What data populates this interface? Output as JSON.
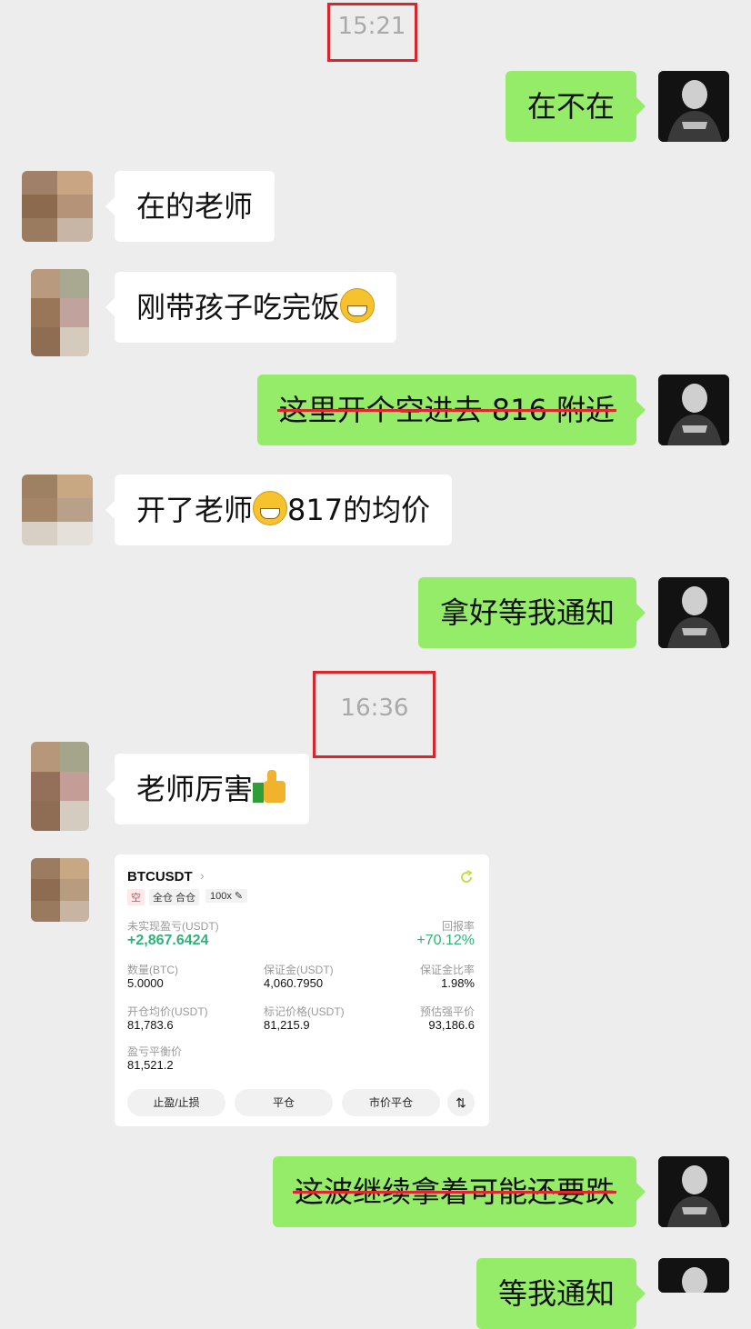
{
  "timestamps": [
    "15:21",
    "16:36"
  ],
  "messages": [
    {
      "text": "在不在"
    },
    {
      "text": "在的老师"
    },
    {
      "text": "刚带孩子吃完饭"
    },
    {
      "text": "这里开个空进去 816 附近"
    },
    {
      "text_before": "开了老师",
      "text_after": "817的均价"
    },
    {
      "text": "拿好等我通知"
    },
    {
      "text": "老师厉害"
    },
    {
      "text": "这波继续拿着可能还要跌"
    },
    {
      "text": "等我通知"
    }
  ],
  "icons": [
    "grinning-face-icon",
    "thumbs-up-icon",
    "refresh-icon",
    "chevron-right-icon",
    "swap-icon"
  ],
  "position_card": {
    "symbol": "BTCUSDT",
    "tag_side": "空",
    "tag_mode": "全仓 合仓",
    "leverage": "100x",
    "unrealized_label": "未实现盈亏(USDT)",
    "unrealized_value": "+2,867.6424",
    "roi_label": "回报率",
    "roi_value": "+70.12%",
    "qty_label": "数量(BTC)",
    "qty_value": "5.0000",
    "margin_label": "保证金(USDT)",
    "margin_value": "4,060.7950",
    "margin_ratio_label": "保证金比率",
    "margin_ratio_value": "1.98%",
    "entry_label": "开仓均价(USDT)",
    "entry_value": "81,783.6",
    "mark_label": "标记价格(USDT)",
    "mark_value": "81,215.9",
    "liq_label": "预估强平价",
    "liq_value": "93,186.6",
    "breakeven_label": "盈亏平衡价",
    "breakeven_value": "81,521.2",
    "buttons": [
      "止盈/止损",
      "平仓",
      "市价平仓"
    ]
  },
  "colors": {
    "out_bubble": "#95ec69",
    "in_bubble": "#ffffff",
    "profit": "#2fb37b",
    "highlight": "#d9262c"
  }
}
